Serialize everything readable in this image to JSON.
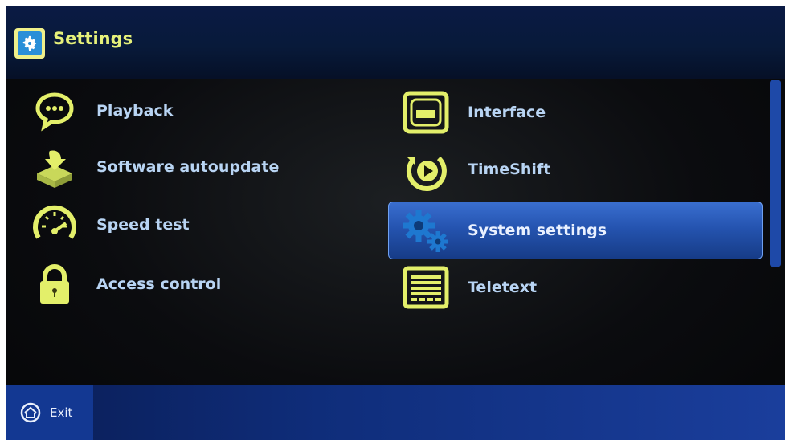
{
  "header": {
    "title": "Settings",
    "icon": "gear-icon"
  },
  "menu": {
    "left": [
      {
        "label": "Playback",
        "icon": "speech-bubble-icon"
      },
      {
        "label": "Software autoupdate",
        "icon": "download-box-icon"
      },
      {
        "label": "Speed test",
        "icon": "speedometer-icon"
      },
      {
        "label": "Access control",
        "icon": "lock-icon"
      }
    ],
    "right": [
      {
        "label": "Interface",
        "icon": "monitor-icon"
      },
      {
        "label": "TimeShift",
        "icon": "timeshift-icon"
      },
      {
        "label": "System settings",
        "icon": "gears-icon",
        "selected": true
      },
      {
        "label": "Teletext",
        "icon": "teletext-icon"
      }
    ]
  },
  "footer": {
    "exit_label": "Exit",
    "exit_icon": "home-circle-icon"
  },
  "colors": {
    "accent": "#E6F17A",
    "label": "#B8D4F3",
    "selection": "#2554B0"
  }
}
